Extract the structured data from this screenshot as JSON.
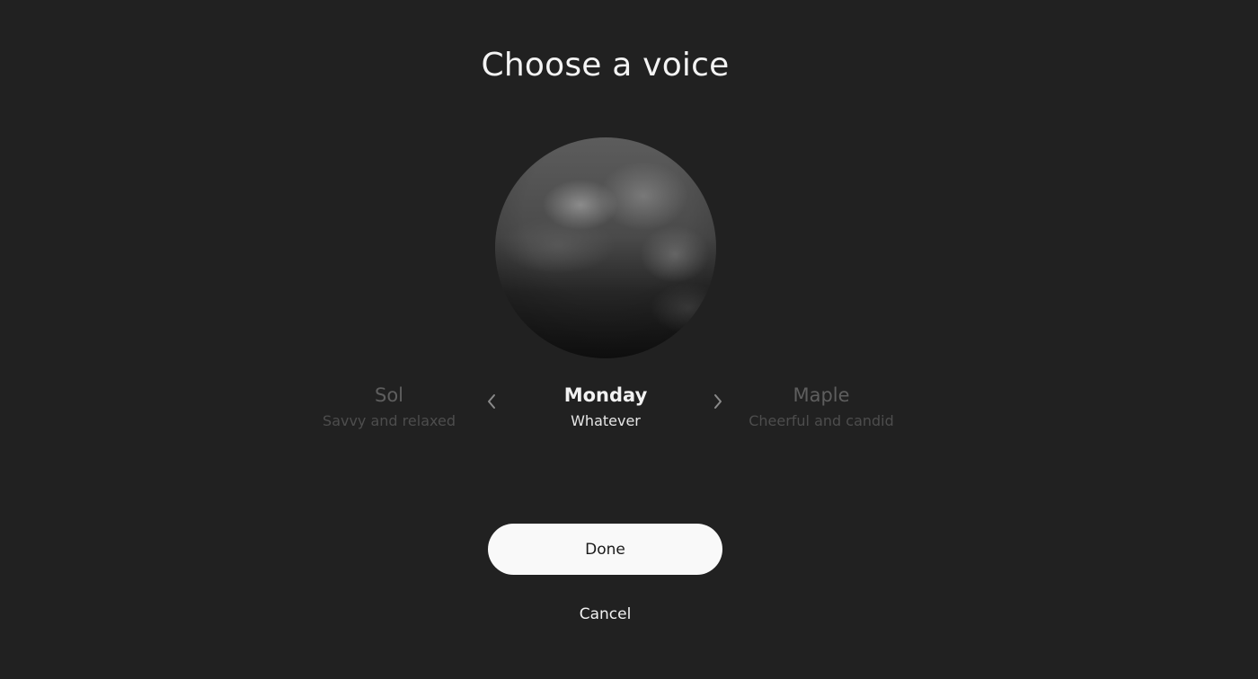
{
  "dialog": {
    "title": "Choose a voice"
  },
  "voices": {
    "previous": {
      "name": "Sol",
      "description": "Savvy and relaxed"
    },
    "selected": {
      "name": "Monday",
      "description": "Whatever"
    },
    "next": {
      "name": "Maple",
      "description": "Cheerful and candid"
    }
  },
  "icons": {
    "prev": "chevron-left-icon",
    "next": "chevron-right-icon"
  },
  "actions": {
    "done_label": "Done",
    "cancel_label": "Cancel"
  },
  "colors": {
    "background": "#212121",
    "primary_button": "#f9f9f9",
    "text": "#f2f2f2",
    "muted_text": "#5e5e5e"
  }
}
